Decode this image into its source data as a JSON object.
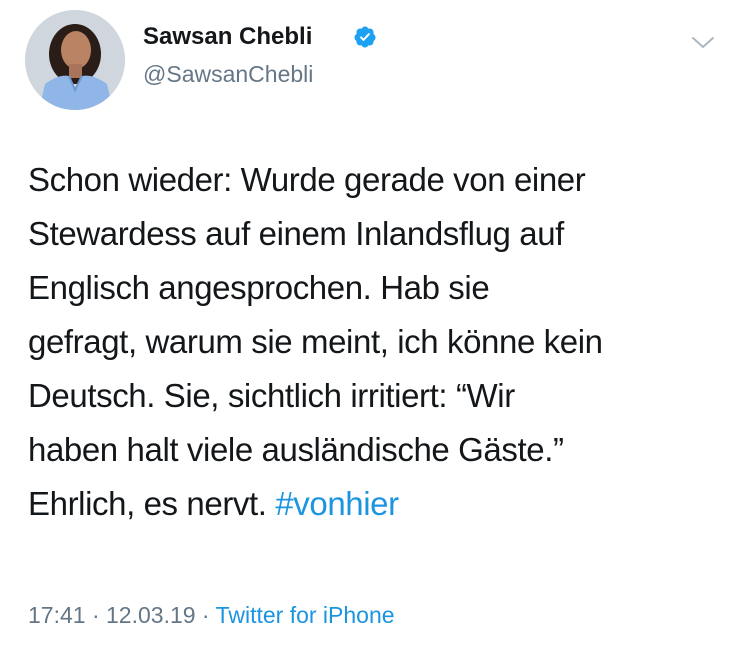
{
  "author": {
    "name": "Sawsan Chebli",
    "handle": "@SawsanChebli"
  },
  "icons": {
    "avatar": "profile-photo",
    "verified": "verified-badge-icon",
    "menu": "chevron-down-icon"
  },
  "tweet": {
    "lines": [
      "Schon wieder: Wurde gerade von einer",
      "Stewardess auf einem Inlandsflug auf",
      "Englisch angesprochen. Hab sie",
      "gefragt, warum sie meint, ich könne kein",
      "Deutsch. Sie, sichtlich irritiert: “Wir",
      "haben halt viele ausländische Gäste.”",
      "Ehrlich, es nervt. "
    ],
    "hashtag": "#vonhier"
  },
  "meta": {
    "time": "17:41",
    "separator": " · ",
    "date": "12.03.19",
    "source": "Twitter for iPhone"
  },
  "colors": {
    "text": "#14171a",
    "secondary": "#657786",
    "link": "#1b95e0",
    "verified": "#1da1f2"
  }
}
